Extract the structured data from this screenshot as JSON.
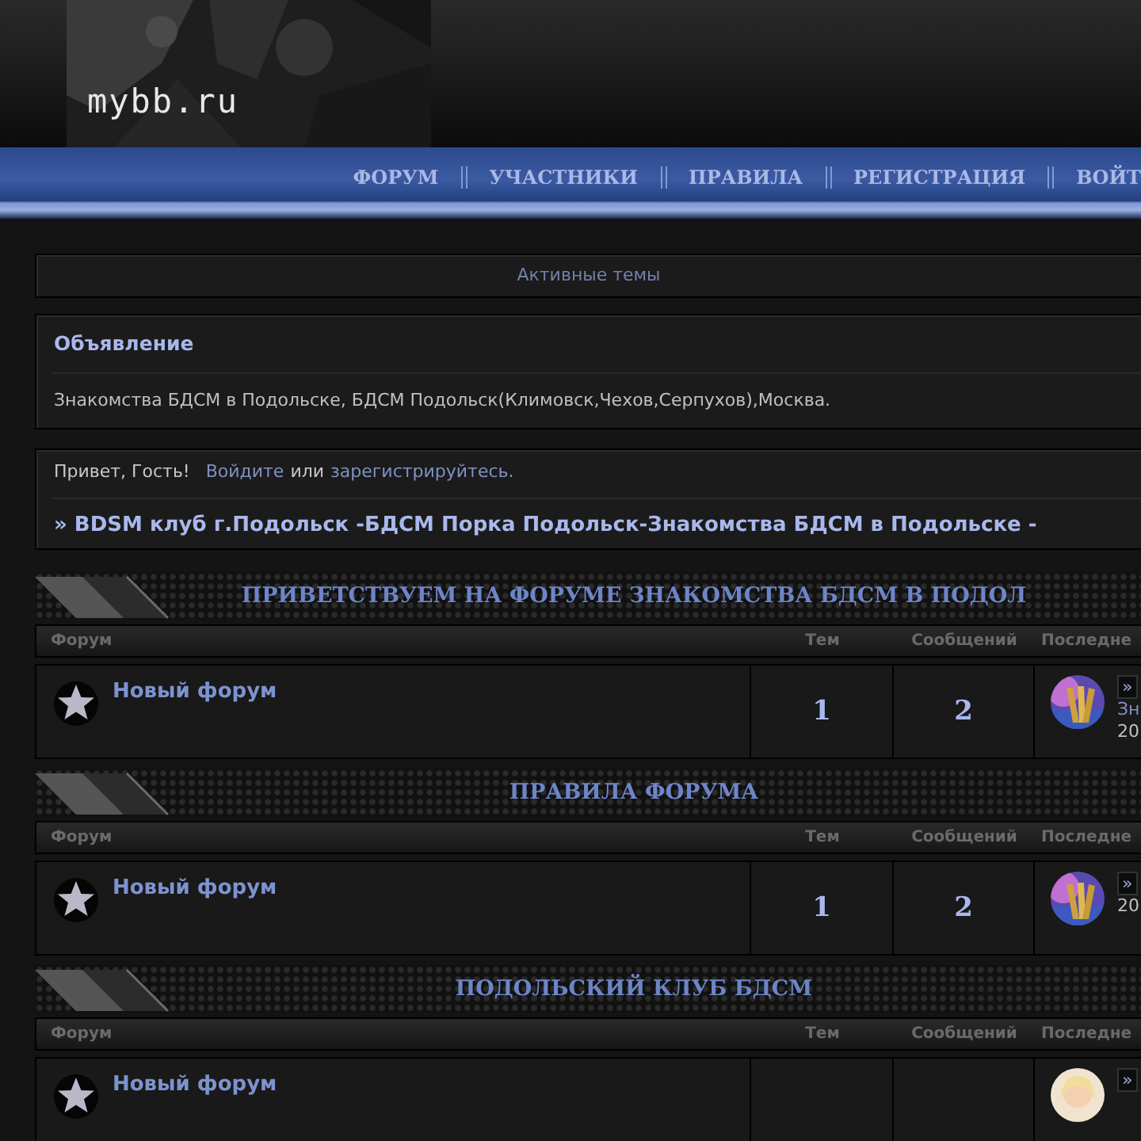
{
  "header": {
    "logo": "mybb.ru"
  },
  "nav": [
    {
      "label": "ФОРУМ"
    },
    {
      "label": "УЧАСТНИКИ"
    },
    {
      "label": "ПРАВИЛА"
    },
    {
      "label": "РЕГИСТРАЦИЯ"
    },
    {
      "label": "ВОЙТ"
    }
  ],
  "active_topics": "Активные темы",
  "announcement": {
    "title": "Объявление",
    "text": "Знакомства БДСМ в Подольске, БДСМ Подольск(Климовск,Чехов,Серпухов),Москва."
  },
  "welcome": {
    "greeting": "Привет, Гость!",
    "login": "Войдите",
    "or": "или",
    "register": "зарегистрируйтесь."
  },
  "board_title": "» BDSM клуб г.Подольск -БДСМ Порка Подольск-Знакомства БДСМ в Подольске -",
  "categories": [
    {
      "title": "ПРИВЕТСТВУЕМ НА ФОРУМЕ ЗНАКОМСТВА БДСМ В ПОДОЛ",
      "columns": [
        "Форум",
        "Тем",
        "Сообщений",
        "Последне"
      ],
      "forums": [
        {
          "name": "Новый форум",
          "topics": "1",
          "posts": "2",
          "last_post": {
            "arrow": "»",
            "lines": [
              "Зн",
              "20"
            ]
          }
        }
      ]
    },
    {
      "title": "ПРАВИЛА ФОРУМА",
      "columns": [
        "Форум",
        "Тем",
        "Сообщений",
        "Последне"
      ],
      "forums": [
        {
          "name": "Новый форум",
          "topics": "1",
          "posts": "2",
          "last_post": {
            "arrow": "»",
            "lines": [
              "20"
            ]
          }
        }
      ]
    },
    {
      "title": "ПОДОЛЬСКИЙ КЛУБ БДСМ",
      "columns": [
        "Форум",
        "Тем",
        "Сообщений",
        "Последне"
      ],
      "forums": [
        {
          "name": "Новый форум",
          "last_post": {
            "arrow": "»"
          }
        }
      ]
    }
  ]
}
